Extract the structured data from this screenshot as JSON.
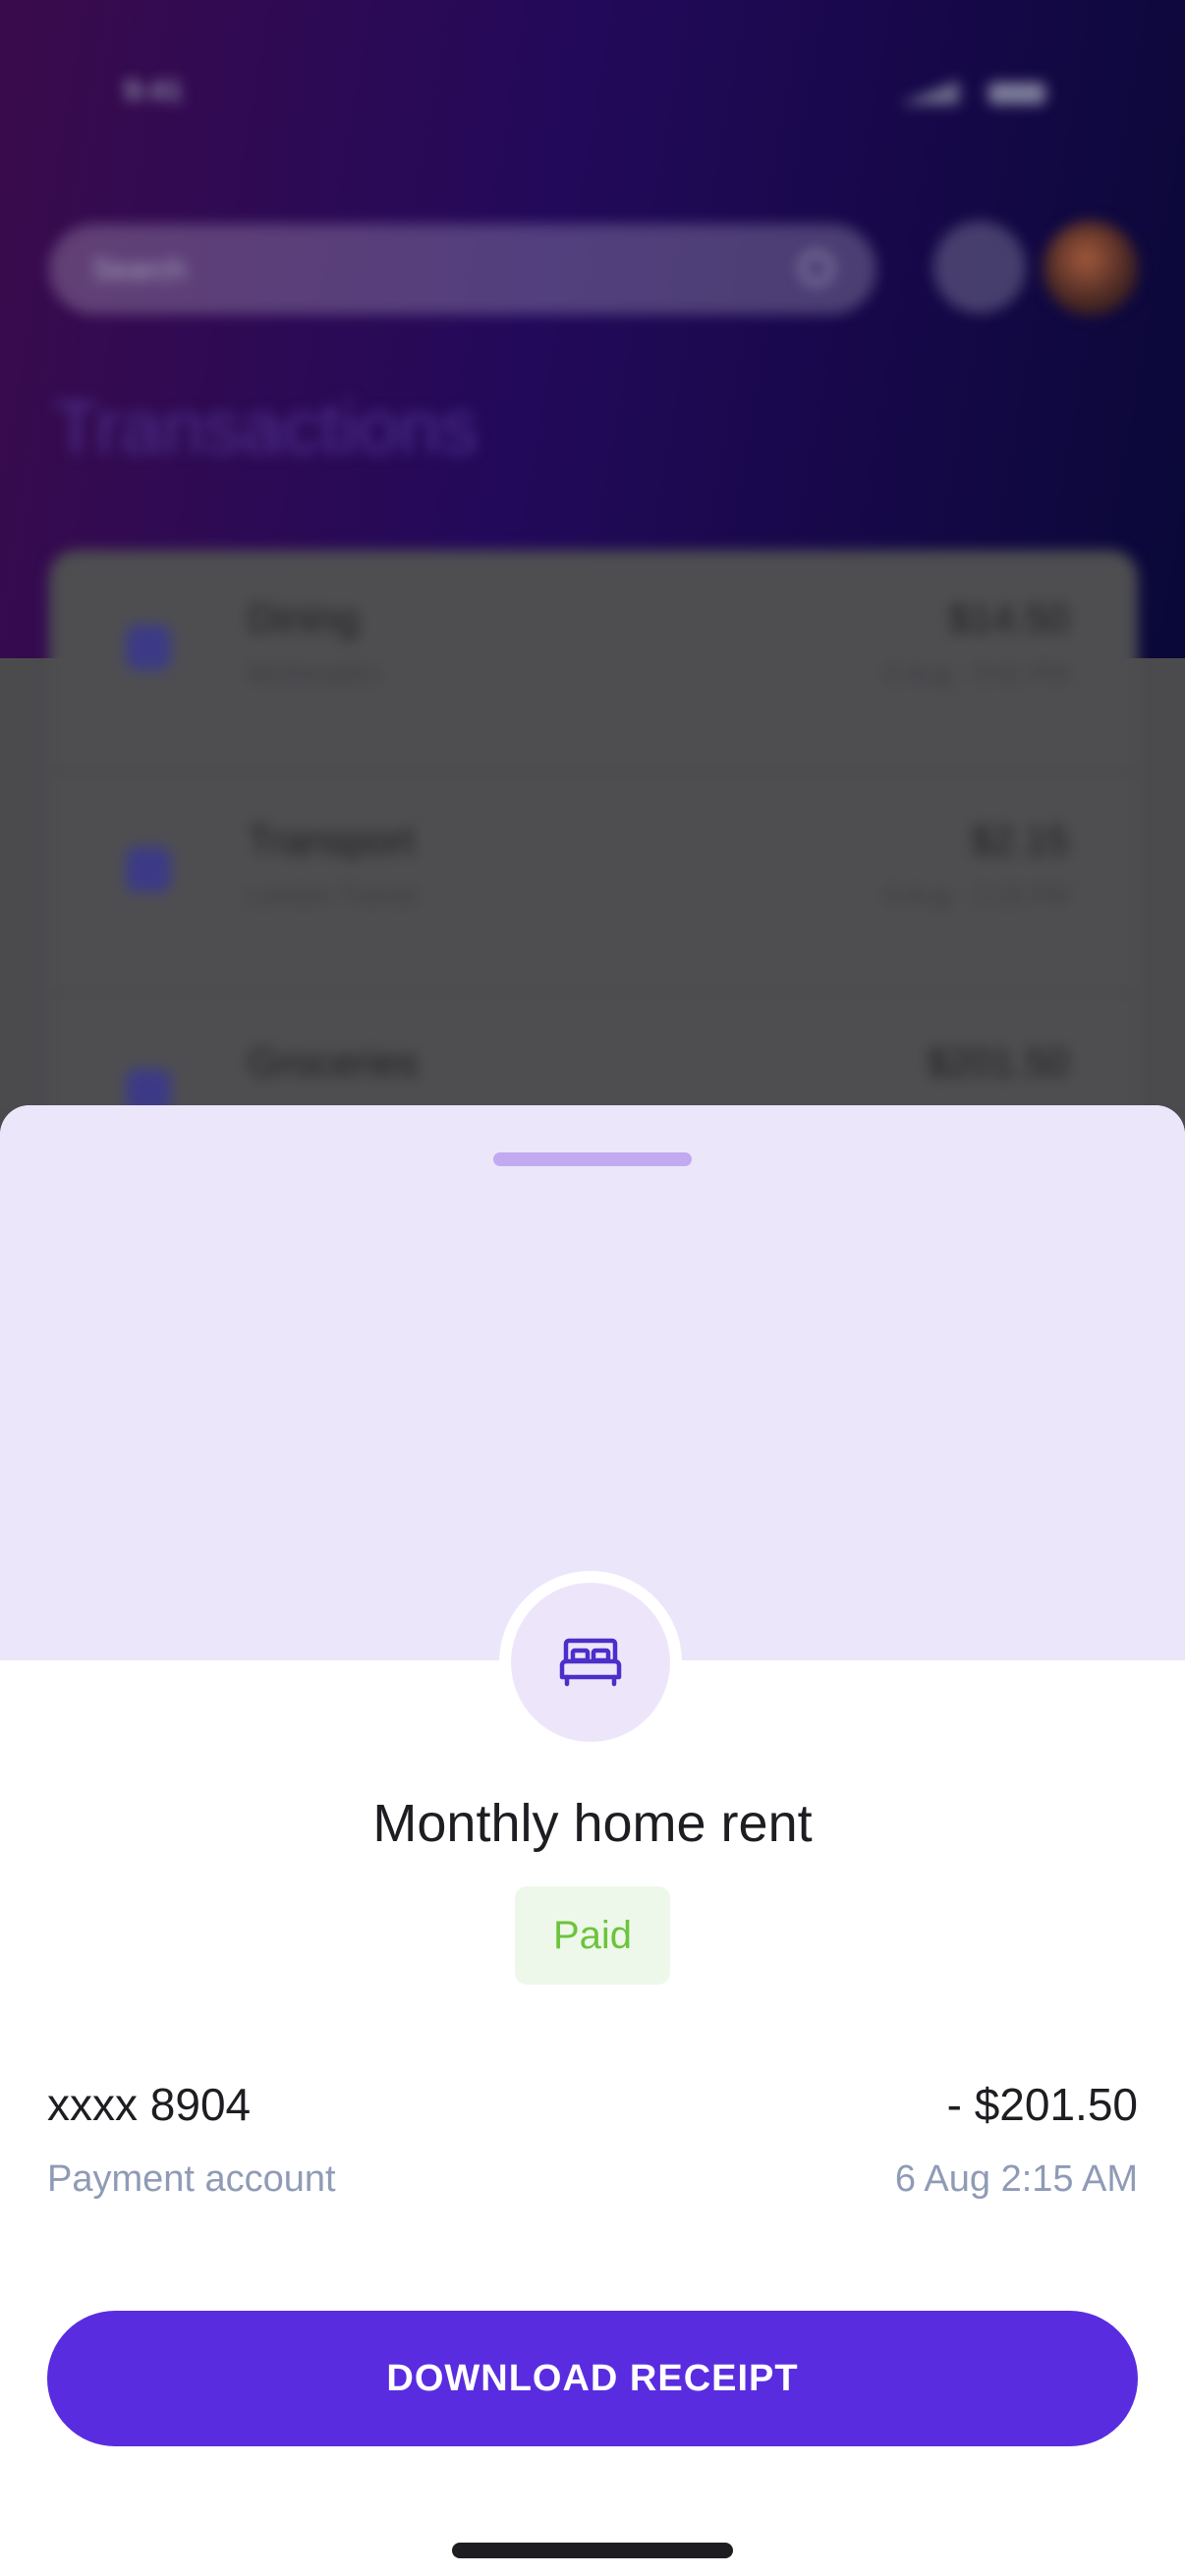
{
  "background_screen": {
    "status_bar": {
      "time": "9:41"
    },
    "search": {
      "placeholder": "Search"
    },
    "title": "Transactions",
    "transactions": [
      {
        "category": "Dining",
        "merchant": "McDonald's",
        "amount": "$14.50",
        "date": "6 Aug · 9:41 PM"
      },
      {
        "category": "Transport",
        "merchant": "London Transit",
        "amount": "$2.15",
        "date": "6 Aug · 2:15 PM"
      },
      {
        "category": "Groceries",
        "merchant": "",
        "amount": "$201.50",
        "date": ""
      }
    ]
  },
  "sheet": {
    "icon": "bed-icon",
    "title": "Monthly home rent",
    "status": "Paid",
    "account_number": "xxxx 8904",
    "account_label": "Payment account",
    "amount": "- $201.50",
    "datetime": "6 Aug 2:15 AM",
    "download_label": "DOWNLOAD RECEIPT"
  },
  "colors": {
    "accent": "#5a2ce0",
    "sheet_top": "#ebe6fa",
    "paid_text": "#6cc43a",
    "paid_bg": "#eef8ea",
    "muted_text": "#8f9bb6"
  }
}
